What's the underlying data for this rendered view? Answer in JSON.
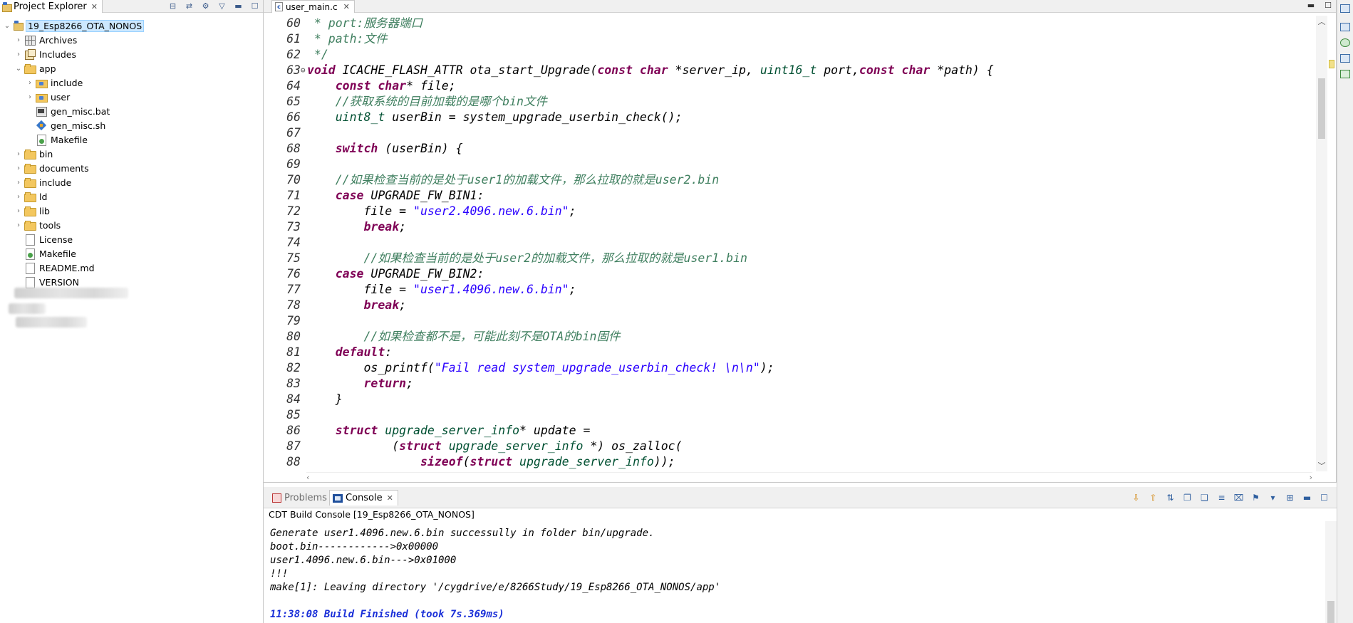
{
  "explorer": {
    "title": "Project Explorer",
    "tree": [
      {
        "label": "19_Esp8266_OTA_NONOS",
        "depth": 0,
        "arrow": "down",
        "icon": "project-icon",
        "selected": true
      },
      {
        "label": "Archives",
        "depth": 1,
        "arrow": "right",
        "icon": "archives-icon"
      },
      {
        "label": "Includes",
        "depth": 1,
        "arrow": "right",
        "icon": "includes-icon"
      },
      {
        "label": "app",
        "depth": 1,
        "arrow": "down",
        "icon": "folder-icon"
      },
      {
        "label": "include",
        "depth": 2,
        "arrow": "right",
        "icon": "source-folder-icon"
      },
      {
        "label": "user",
        "depth": 2,
        "arrow": "right",
        "icon": "source-folder-icon"
      },
      {
        "label": "gen_misc.bat",
        "depth": 2,
        "arrow": "",
        "icon": "bat-file-icon"
      },
      {
        "label": "gen_misc.sh",
        "depth": 2,
        "arrow": "",
        "icon": "shell-file-icon"
      },
      {
        "label": "Makefile",
        "depth": 2,
        "arrow": "",
        "icon": "makefile-icon"
      },
      {
        "label": "bin",
        "depth": 1,
        "arrow": "right",
        "icon": "folder-icon"
      },
      {
        "label": "documents",
        "depth": 1,
        "arrow": "right",
        "icon": "folder-icon"
      },
      {
        "label": "include",
        "depth": 1,
        "arrow": "right",
        "icon": "folder-icon"
      },
      {
        "label": "ld",
        "depth": 1,
        "arrow": "right",
        "icon": "folder-icon"
      },
      {
        "label": "lib",
        "depth": 1,
        "arrow": "right",
        "icon": "folder-icon"
      },
      {
        "label": "tools",
        "depth": 1,
        "arrow": "right",
        "icon": "folder-icon"
      },
      {
        "label": "License",
        "depth": 1,
        "arrow": "",
        "icon": "file-icon"
      },
      {
        "label": "Makefile",
        "depth": 1,
        "arrow": "",
        "icon": "makefile-icon"
      },
      {
        "label": "README.md",
        "depth": 1,
        "arrow": "",
        "icon": "file-icon"
      },
      {
        "label": "VERSION",
        "depth": 1,
        "arrow": "",
        "icon": "file-icon"
      }
    ]
  },
  "editor": {
    "tab_label": "user_main.c",
    "lines": [
      {
        "ln": "60",
        "seg": [
          [
            "cm",
            " * port:服务器端口"
          ]
        ]
      },
      {
        "ln": "61",
        "seg": [
          [
            "cm",
            " * path:文件"
          ]
        ]
      },
      {
        "ln": "62",
        "seg": [
          [
            "cm",
            " */"
          ]
        ]
      },
      {
        "ln": "63",
        "fold": true,
        "seg": [
          [
            "kw",
            "void"
          ],
          [
            "n",
            " ICACHE_FLASH_ATTR ota_start_Upgrade("
          ],
          [
            "kw",
            "const"
          ],
          [
            "n",
            " "
          ],
          [
            "kw",
            "char"
          ],
          [
            "n",
            " *server_ip, "
          ],
          [
            "type",
            "uint16_t"
          ],
          [
            "n",
            " port,"
          ],
          [
            "kw",
            "const"
          ],
          [
            "n",
            " "
          ],
          [
            "kw",
            "char"
          ],
          [
            "n",
            " *path) {"
          ]
        ]
      },
      {
        "ln": "64",
        "seg": [
          [
            "n",
            "    "
          ],
          [
            "kw",
            "const"
          ],
          [
            "n",
            " "
          ],
          [
            "kw",
            "char"
          ],
          [
            "n",
            "* file;"
          ]
        ]
      },
      {
        "ln": "65",
        "seg": [
          [
            "cm",
            "    //获取系统的目前加载的是哪个bin文件"
          ]
        ]
      },
      {
        "ln": "66",
        "seg": [
          [
            "n",
            "    "
          ],
          [
            "type",
            "uint8_t"
          ],
          [
            "n",
            " userBin = system_upgrade_userbin_check();"
          ]
        ]
      },
      {
        "ln": "67",
        "seg": []
      },
      {
        "ln": "68",
        "seg": [
          [
            "n",
            "    "
          ],
          [
            "kw",
            "switch"
          ],
          [
            "n",
            " (userBin) {"
          ]
        ]
      },
      {
        "ln": "69",
        "seg": []
      },
      {
        "ln": "70",
        "seg": [
          [
            "cm",
            "    //如果检查当前的是处于user1的加载文件，那么拉取的就是user2.bin"
          ]
        ]
      },
      {
        "ln": "71",
        "seg": [
          [
            "n",
            "    "
          ],
          [
            "kw",
            "case"
          ],
          [
            "n",
            " UPGRADE_FW_BIN1:"
          ]
        ]
      },
      {
        "ln": "72",
        "seg": [
          [
            "n",
            "        file = "
          ],
          [
            "str",
            "\"user2.4096.new.6.bin\""
          ],
          [
            "n",
            ";"
          ]
        ]
      },
      {
        "ln": "73",
        "seg": [
          [
            "n",
            "        "
          ],
          [
            "kw",
            "break"
          ],
          [
            "n",
            ";"
          ]
        ]
      },
      {
        "ln": "74",
        "seg": []
      },
      {
        "ln": "75",
        "seg": [
          [
            "cm",
            "        //如果检查当前的是处于user2的加载文件，那么拉取的就是user1.bin"
          ]
        ]
      },
      {
        "ln": "76",
        "seg": [
          [
            "n",
            "    "
          ],
          [
            "kw",
            "case"
          ],
          [
            "n",
            " UPGRADE_FW_BIN2:"
          ]
        ]
      },
      {
        "ln": "77",
        "seg": [
          [
            "n",
            "        file = "
          ],
          [
            "str",
            "\"user1.4096.new.6.bin\""
          ],
          [
            "n",
            ";"
          ]
        ]
      },
      {
        "ln": "78",
        "seg": [
          [
            "n",
            "        "
          ],
          [
            "kw",
            "break"
          ],
          [
            "n",
            ";"
          ]
        ]
      },
      {
        "ln": "79",
        "seg": []
      },
      {
        "ln": "80",
        "seg": [
          [
            "cm",
            "        //如果检查都不是，可能此刻不是OTA的bin固件"
          ]
        ]
      },
      {
        "ln": "81",
        "seg": [
          [
            "n",
            "    "
          ],
          [
            "kw",
            "default"
          ],
          [
            "n",
            ":"
          ]
        ]
      },
      {
        "ln": "82",
        "seg": [
          [
            "n",
            "        os_printf("
          ],
          [
            "str",
            "\"Fail read system_upgrade_userbin_check! \\n\\n\""
          ],
          [
            "n",
            ");"
          ]
        ]
      },
      {
        "ln": "83",
        "seg": [
          [
            "n",
            "        "
          ],
          [
            "kw",
            "return"
          ],
          [
            "n",
            ";"
          ]
        ]
      },
      {
        "ln": "84",
        "seg": [
          [
            "n",
            "    }"
          ]
        ]
      },
      {
        "ln": "85",
        "seg": []
      },
      {
        "ln": "86",
        "seg": [
          [
            "n",
            "    "
          ],
          [
            "kw",
            "struct"
          ],
          [
            "n",
            " "
          ],
          [
            "type",
            "upgrade_server_info"
          ],
          [
            "n",
            "* update ="
          ]
        ]
      },
      {
        "ln": "87",
        "seg": [
          [
            "n",
            "            ("
          ],
          [
            "kw",
            "struct"
          ],
          [
            "n",
            " "
          ],
          [
            "type",
            "upgrade_server_info"
          ],
          [
            "n",
            " *) os_zalloc("
          ]
        ]
      },
      {
        "ln": "88",
        "seg": [
          [
            "n",
            "                "
          ],
          [
            "kw",
            "sizeof"
          ],
          [
            "n",
            "("
          ],
          [
            "kw",
            "struct"
          ],
          [
            "n",
            " "
          ],
          [
            "type",
            "upgrade_server_info"
          ],
          [
            "n",
            "));"
          ]
        ]
      }
    ]
  },
  "console": {
    "tabs": {
      "problems": "Problems",
      "console": "Console"
    },
    "title": "CDT Build Console [19_Esp8266_OTA_NONOS]",
    "lines": [
      {
        "text": "Generate user1.4096.new.6.bin successully in folder bin/upgrade.",
        "style": "normal"
      },
      {
        "text": "boot.bin------------>0x00000",
        "style": "normal"
      },
      {
        "text": "user1.4096.new.6.bin--->0x01000",
        "style": "normal"
      },
      {
        "text": "!!!",
        "style": "normal"
      },
      {
        "text": "make[1]: Leaving directory '/cygdrive/e/8266Study/19_Esp8266_OTA_NONOS/app'",
        "style": "normal"
      },
      {
        "text": "",
        "style": "normal"
      },
      {
        "text": "11:38:08 Build Finished (took 7s.369ms)",
        "style": "blue"
      }
    ]
  },
  "colors": {
    "keyword": "#7f0055",
    "type": "#005032",
    "comment": "#3f7f5f",
    "string": "#2a00ff",
    "selection": "#cce8ff",
    "build_finished": "#1a2fd8"
  }
}
